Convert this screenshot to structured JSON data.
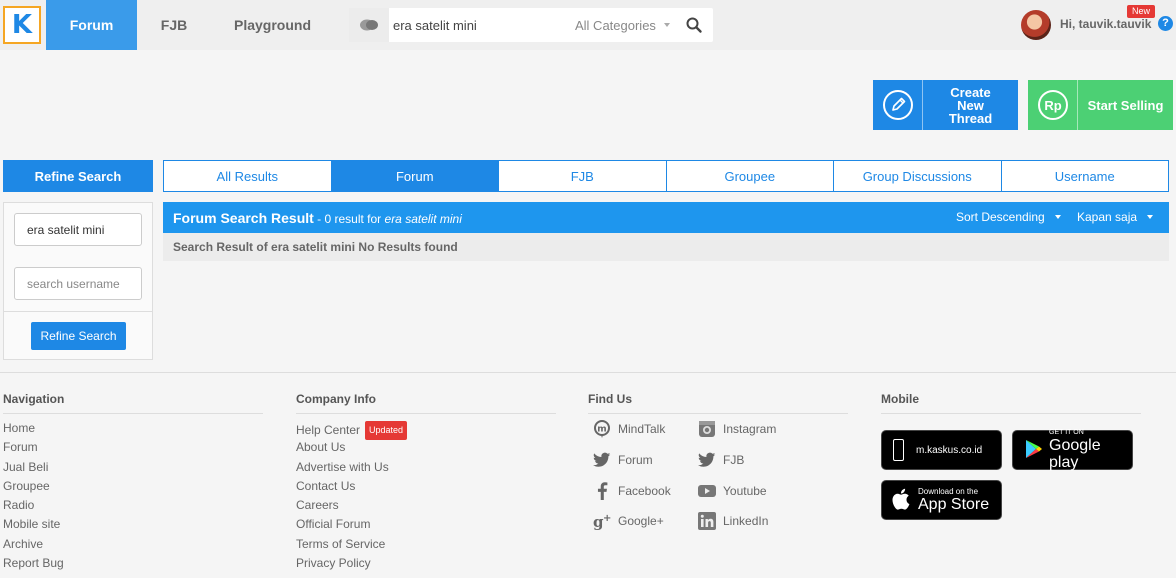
{
  "header": {
    "logo_text": "K",
    "tabs": [
      {
        "label": "Forum",
        "active": true
      },
      {
        "label": "FJB",
        "active": false
      },
      {
        "label": "Playground",
        "active": false
      }
    ],
    "search": {
      "value": "era satelit mini",
      "category": "All Categories"
    },
    "user": {
      "greeting": "Hi, tauvik.tauvik",
      "badge": "New"
    },
    "help": "?"
  },
  "actions": {
    "create_thread": "Create New Thread",
    "start_selling": "Start Selling",
    "rp": "Rp"
  },
  "refine": {
    "title": "Refine Search",
    "keyword_value": "era satelit mini",
    "username_placeholder": "search username",
    "button": "Refine Search"
  },
  "result_tabs": [
    {
      "label": "All Results",
      "active": false
    },
    {
      "label": "Forum",
      "active": true
    },
    {
      "label": "FJB",
      "active": false
    },
    {
      "label": "Groupee",
      "active": false
    },
    {
      "label": "Group Discussions",
      "active": false
    },
    {
      "label": "Username",
      "active": false
    }
  ],
  "results": {
    "title": "Forum Search Result",
    "count_prefix": " - 0 result for ",
    "query": "era satelit mini",
    "sort": "Sort Descending",
    "time": "Kapan saja",
    "empty_message": "Search Result of era satelit mini No Results found"
  },
  "footer": {
    "navigation": {
      "title": "Navigation",
      "items": [
        "Home",
        "Forum",
        "Jual Beli",
        "Groupee",
        "Radio",
        "Mobile site",
        "Archive",
        "Report Bug"
      ]
    },
    "company": {
      "title": "Company Info",
      "items": [
        "Help Center",
        "About Us",
        "Advertise with Us",
        "Contact Us",
        "Careers",
        "Official Forum",
        "Terms of Service",
        "Privacy Policy"
      ],
      "updated_badge": "Updated"
    },
    "find_us": {
      "title": "Find Us",
      "items": [
        {
          "label": "MindTalk",
          "icon": "mindtalk-icon"
        },
        {
          "label": "Instagram",
          "icon": "instagram-icon"
        },
        {
          "label": "Forum",
          "icon": "twitter-icon"
        },
        {
          "label": "FJB",
          "icon": "twitter-icon"
        },
        {
          "label": "Facebook",
          "icon": "facebook-icon"
        },
        {
          "label": "Youtube",
          "icon": "youtube-icon"
        },
        {
          "label": "Google+",
          "icon": "google-plus-icon"
        },
        {
          "label": "LinkedIn",
          "icon": "linkedin-icon"
        }
      ]
    },
    "mobile": {
      "title": "Mobile",
      "mobile_site": "m.kaskus.co.id",
      "google_small": "GET IT ON",
      "google_big": "Google play",
      "apple_small": "Download on the",
      "apple_big": "App Store"
    }
  },
  "colors": {
    "primary": "#1e88e5",
    "sell": "#4cd074",
    "logo_border": "#f5a623",
    "badge": "#e53935"
  }
}
